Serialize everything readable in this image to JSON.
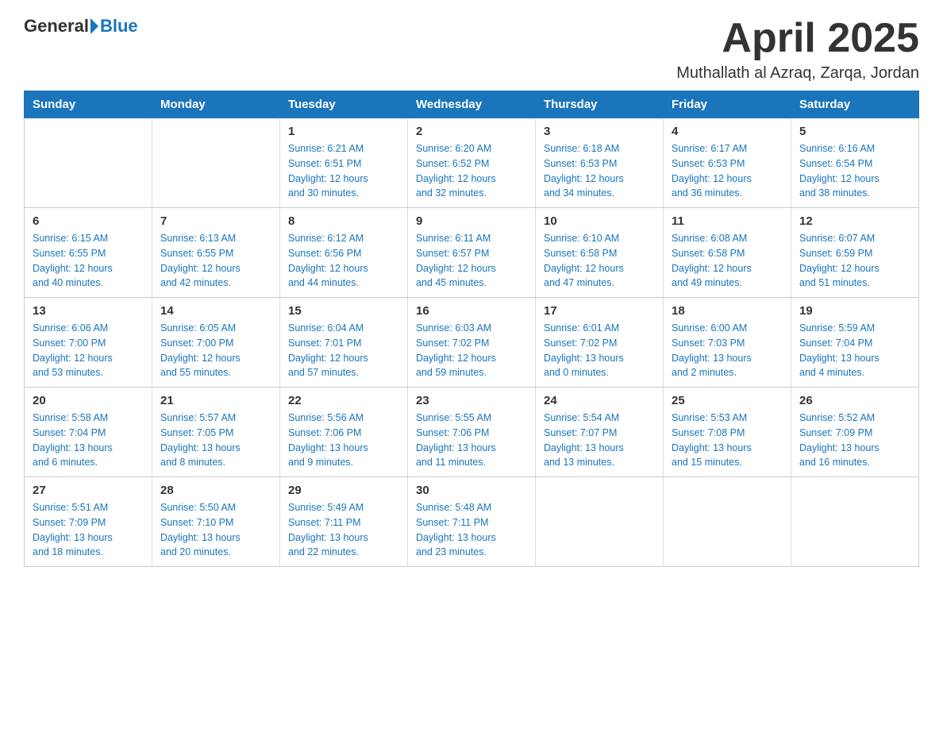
{
  "header": {
    "logo_general": "General",
    "logo_blue": "Blue",
    "month_title": "April 2025",
    "location": "Muthallath al Azraq, Zarqa, Jordan"
  },
  "weekdays": [
    "Sunday",
    "Monday",
    "Tuesday",
    "Wednesday",
    "Thursday",
    "Friday",
    "Saturday"
  ],
  "weeks": [
    [
      {
        "day": "",
        "info": ""
      },
      {
        "day": "",
        "info": ""
      },
      {
        "day": "1",
        "info": "Sunrise: 6:21 AM\nSunset: 6:51 PM\nDaylight: 12 hours\nand 30 minutes."
      },
      {
        "day": "2",
        "info": "Sunrise: 6:20 AM\nSunset: 6:52 PM\nDaylight: 12 hours\nand 32 minutes."
      },
      {
        "day": "3",
        "info": "Sunrise: 6:18 AM\nSunset: 6:53 PM\nDaylight: 12 hours\nand 34 minutes."
      },
      {
        "day": "4",
        "info": "Sunrise: 6:17 AM\nSunset: 6:53 PM\nDaylight: 12 hours\nand 36 minutes."
      },
      {
        "day": "5",
        "info": "Sunrise: 6:16 AM\nSunset: 6:54 PM\nDaylight: 12 hours\nand 38 minutes."
      }
    ],
    [
      {
        "day": "6",
        "info": "Sunrise: 6:15 AM\nSunset: 6:55 PM\nDaylight: 12 hours\nand 40 minutes."
      },
      {
        "day": "7",
        "info": "Sunrise: 6:13 AM\nSunset: 6:55 PM\nDaylight: 12 hours\nand 42 minutes."
      },
      {
        "day": "8",
        "info": "Sunrise: 6:12 AM\nSunset: 6:56 PM\nDaylight: 12 hours\nand 44 minutes."
      },
      {
        "day": "9",
        "info": "Sunrise: 6:11 AM\nSunset: 6:57 PM\nDaylight: 12 hours\nand 45 minutes."
      },
      {
        "day": "10",
        "info": "Sunrise: 6:10 AM\nSunset: 6:58 PM\nDaylight: 12 hours\nand 47 minutes."
      },
      {
        "day": "11",
        "info": "Sunrise: 6:08 AM\nSunset: 6:58 PM\nDaylight: 12 hours\nand 49 minutes."
      },
      {
        "day": "12",
        "info": "Sunrise: 6:07 AM\nSunset: 6:59 PM\nDaylight: 12 hours\nand 51 minutes."
      }
    ],
    [
      {
        "day": "13",
        "info": "Sunrise: 6:06 AM\nSunset: 7:00 PM\nDaylight: 12 hours\nand 53 minutes."
      },
      {
        "day": "14",
        "info": "Sunrise: 6:05 AM\nSunset: 7:00 PM\nDaylight: 12 hours\nand 55 minutes."
      },
      {
        "day": "15",
        "info": "Sunrise: 6:04 AM\nSunset: 7:01 PM\nDaylight: 12 hours\nand 57 minutes."
      },
      {
        "day": "16",
        "info": "Sunrise: 6:03 AM\nSunset: 7:02 PM\nDaylight: 12 hours\nand 59 minutes."
      },
      {
        "day": "17",
        "info": "Sunrise: 6:01 AM\nSunset: 7:02 PM\nDaylight: 13 hours\nand 0 minutes."
      },
      {
        "day": "18",
        "info": "Sunrise: 6:00 AM\nSunset: 7:03 PM\nDaylight: 13 hours\nand 2 minutes."
      },
      {
        "day": "19",
        "info": "Sunrise: 5:59 AM\nSunset: 7:04 PM\nDaylight: 13 hours\nand 4 minutes."
      }
    ],
    [
      {
        "day": "20",
        "info": "Sunrise: 5:58 AM\nSunset: 7:04 PM\nDaylight: 13 hours\nand 6 minutes."
      },
      {
        "day": "21",
        "info": "Sunrise: 5:57 AM\nSunset: 7:05 PM\nDaylight: 13 hours\nand 8 minutes."
      },
      {
        "day": "22",
        "info": "Sunrise: 5:56 AM\nSunset: 7:06 PM\nDaylight: 13 hours\nand 9 minutes."
      },
      {
        "day": "23",
        "info": "Sunrise: 5:55 AM\nSunset: 7:06 PM\nDaylight: 13 hours\nand 11 minutes."
      },
      {
        "day": "24",
        "info": "Sunrise: 5:54 AM\nSunset: 7:07 PM\nDaylight: 13 hours\nand 13 minutes."
      },
      {
        "day": "25",
        "info": "Sunrise: 5:53 AM\nSunset: 7:08 PM\nDaylight: 13 hours\nand 15 minutes."
      },
      {
        "day": "26",
        "info": "Sunrise: 5:52 AM\nSunset: 7:09 PM\nDaylight: 13 hours\nand 16 minutes."
      }
    ],
    [
      {
        "day": "27",
        "info": "Sunrise: 5:51 AM\nSunset: 7:09 PM\nDaylight: 13 hours\nand 18 minutes."
      },
      {
        "day": "28",
        "info": "Sunrise: 5:50 AM\nSunset: 7:10 PM\nDaylight: 13 hours\nand 20 minutes."
      },
      {
        "day": "29",
        "info": "Sunrise: 5:49 AM\nSunset: 7:11 PM\nDaylight: 13 hours\nand 22 minutes."
      },
      {
        "day": "30",
        "info": "Sunrise: 5:48 AM\nSunset: 7:11 PM\nDaylight: 13 hours\nand 23 minutes."
      },
      {
        "day": "",
        "info": ""
      },
      {
        "day": "",
        "info": ""
      },
      {
        "day": "",
        "info": ""
      }
    ]
  ]
}
